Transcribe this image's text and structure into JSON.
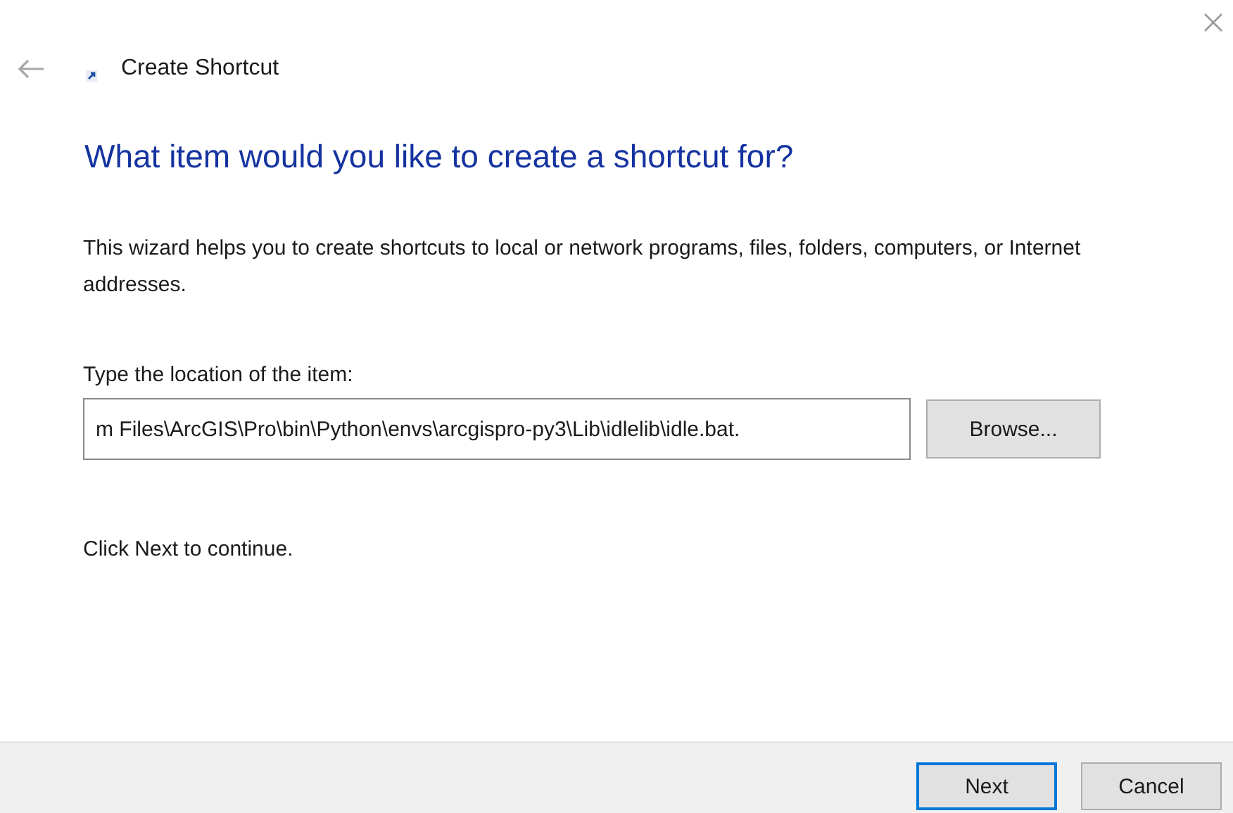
{
  "window": {
    "title": "Create Shortcut"
  },
  "heading": "What item would you like to create a shortcut for?",
  "description": "This wizard helps you to create shortcuts to local or network programs, files, folders, computers, or Internet addresses.",
  "location": {
    "label": "Type the location of the item:",
    "value": "m Files\\ArcGIS\\Pro\\bin\\Python\\envs\\arcgispro-py3\\Lib\\idlelib\\idle.bat."
  },
  "browse_button": "Browse...",
  "hint": "Click Next to continue.",
  "buttons": [
    {
      "label": "Next",
      "selected": true
    },
    {
      "label": "Cancel",
      "selected": false
    }
  ]
}
